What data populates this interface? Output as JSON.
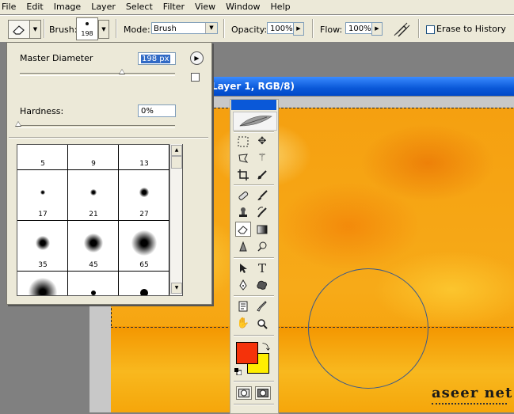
{
  "menu": [
    "File",
    "Edit",
    "Image",
    "Layer",
    "Select",
    "Filter",
    "View",
    "Window",
    "Help"
  ],
  "options": {
    "brush_label": "Brush:",
    "brush_size": "198",
    "mode_label": "Mode:",
    "mode_value": "Brush",
    "opacity_label": "Opacity:",
    "opacity_value": "100%",
    "flow_label": "Flow:",
    "flow_value": "100%",
    "erase_history_label": "Erase to History",
    "erase_history_checked": false
  },
  "brush_panel": {
    "master_diameter_label": "Master Diameter",
    "master_diameter_value": "198 px",
    "master_diameter_fraction": 0.66,
    "hardness_label": "Hardness:",
    "hardness_value": "0%",
    "hardness_fraction": 0.0,
    "presets": [
      {
        "size": "5"
      },
      {
        "size": "9"
      },
      {
        "size": "13"
      },
      {
        "size": "17"
      },
      {
        "size": "21"
      },
      {
        "size": "27"
      },
      {
        "size": "35"
      },
      {
        "size": "45"
      },
      {
        "size": "65"
      }
    ]
  },
  "document": {
    "title": "Layer 1, RGB/8)"
  },
  "colors": {
    "foreground": "#f5320a",
    "background": "#ffee00",
    "title_bar": "#0a58d8"
  },
  "watermark": "aseer net"
}
